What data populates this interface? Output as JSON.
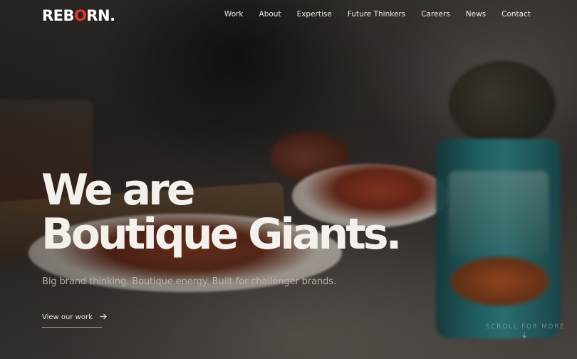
{
  "brand": {
    "logo_text_start": "REB",
    "logo_text_accent": "O",
    "logo_text_end": "RN.",
    "accent_color": "#e8352c"
  },
  "nav": {
    "items": [
      {
        "label": "Work"
      },
      {
        "label": "About"
      },
      {
        "label": "Expertise"
      },
      {
        "label": "Future Thinkers"
      },
      {
        "label": "Careers"
      },
      {
        "label": "News"
      },
      {
        "label": "Contact"
      }
    ]
  },
  "hero": {
    "headline_line1": "We are",
    "headline_line2": "Boutique Giants.",
    "subline": "Big brand thinking. Boutique energy. Built for challenger brands.",
    "cta_label": "View our work",
    "cta_icon": "arrow-right-icon",
    "scroll_label": "SCROLL FOR MORE",
    "scroll_icon": "arrow-down-icon"
  }
}
